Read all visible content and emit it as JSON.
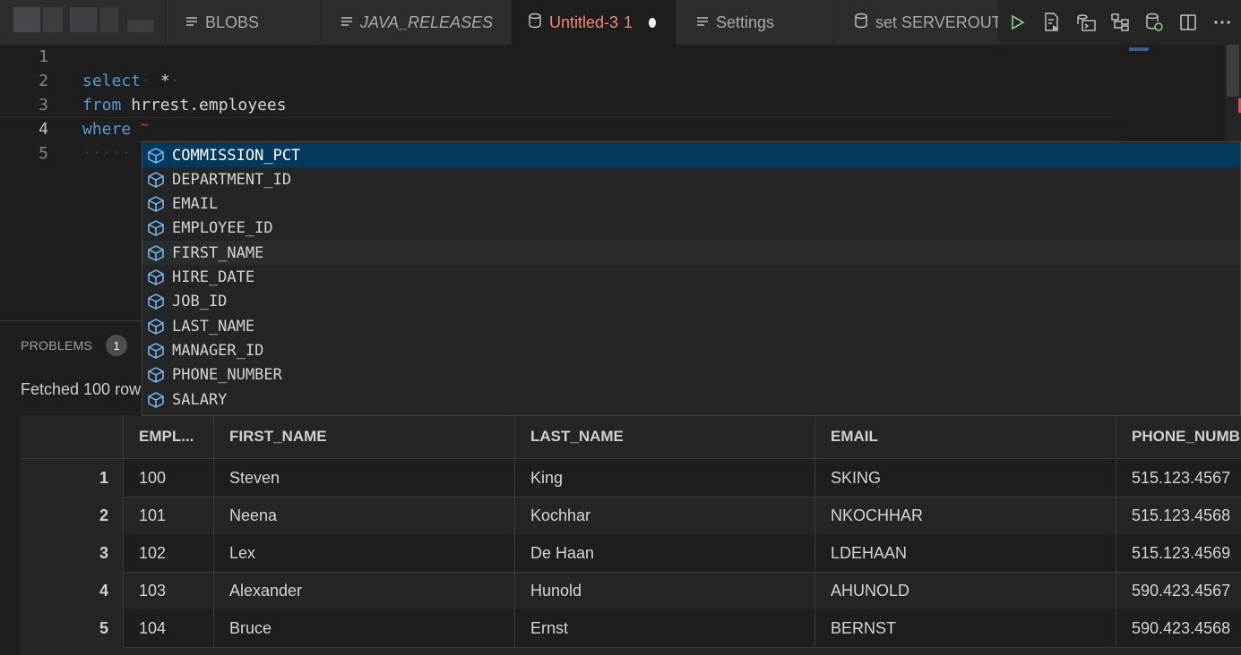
{
  "tabs": [
    {
      "label": "BLOBS",
      "icon": "lines-icon",
      "italic": false
    },
    {
      "label": "JAVA_RELEASES",
      "icon": "lines-icon",
      "italic": true
    },
    {
      "label": "Untitled-3",
      "badge": "1",
      "icon": "database-icon",
      "active": true,
      "dirty": true
    },
    {
      "label": "Settings",
      "icon": "lines-icon",
      "italic": false
    },
    {
      "label": "set SERVEROUTP",
      "icon": "database-icon",
      "italic": false
    }
  ],
  "editor": {
    "lines": [
      {
        "number": "1",
        "tokens": []
      },
      {
        "number": "2",
        "tokens": [
          {
            "t": "select",
            "kw": true
          },
          {
            "t": " *"
          }
        ]
      },
      {
        "number": "3",
        "tokens": [
          {
            "t": "from",
            "kw": true
          },
          {
            "t": " hrrest.employees"
          }
        ]
      },
      {
        "number": "4",
        "tokens": [
          {
            "t": "where",
            "kw": true
          },
          {
            "t": " "
          }
        ]
      },
      {
        "number": "5",
        "tokens": []
      }
    ],
    "current_line": "4"
  },
  "suggestions": {
    "items": [
      "COMMISSION_PCT",
      "DEPARTMENT_ID",
      "EMAIL",
      "EMPLOYEE_ID",
      "FIRST_NAME",
      "HIRE_DATE",
      "JOB_ID",
      "LAST_NAME",
      "MANAGER_ID",
      "PHONE_NUMBER",
      "SALARY"
    ],
    "selected_index": 0,
    "hover_index": 4
  },
  "panel": {
    "problems_label": "PROBLEMS",
    "problems_count": "1",
    "status_text": "Fetched 100 row"
  },
  "results": {
    "columns": [
      "",
      "EMPL...",
      "FIRST_NAME",
      "LAST_NAME",
      "EMAIL",
      "PHONE_NUMBE"
    ],
    "rows": [
      [
        "1",
        "100",
        "Steven",
        "King",
        "SKING",
        "515.123.4567"
      ],
      [
        "2",
        "101",
        "Neena",
        "Kochhar",
        "NKOCHHAR",
        "515.123.4568"
      ],
      [
        "3",
        "102",
        "Lex",
        "De Haan",
        "LDEHAAN",
        "515.123.4569"
      ],
      [
        "4",
        "103",
        "Alexander",
        "Hunold",
        "AHUNOLD",
        "590.423.4567"
      ],
      [
        "5",
        "104",
        "Bruce",
        "Ernst",
        "BERNST",
        "590.423.4568"
      ]
    ]
  },
  "colors": {
    "keyword": "#569cd6",
    "active_tab_text": "#f48771",
    "selection": "#04395e",
    "run_green": "#89d185"
  }
}
